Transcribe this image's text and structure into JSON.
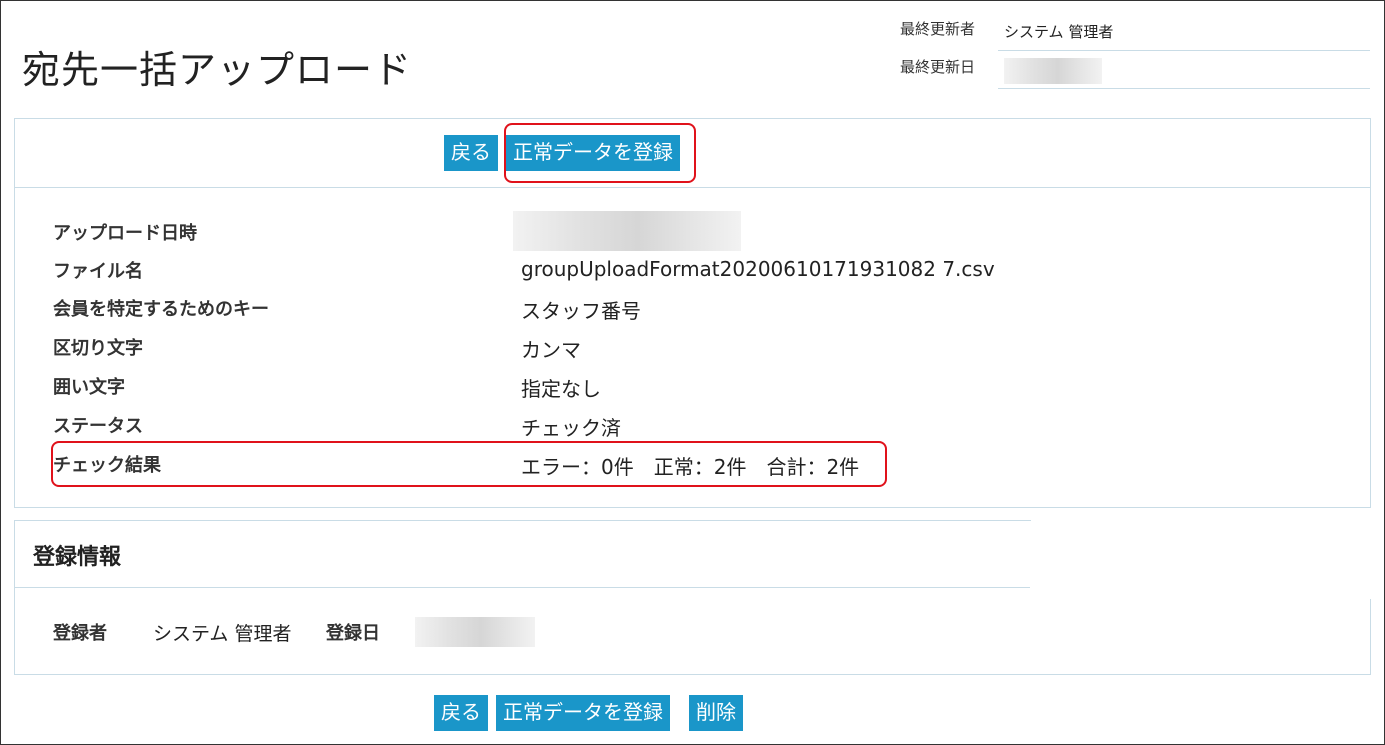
{
  "page": {
    "title": "宛先一括アップロード"
  },
  "meta": {
    "last_updated_by_label": "最終更新者",
    "last_updated_by_value": "システム 管理者",
    "last_updated_date_label": "最終更新日"
  },
  "toolbar_top": {
    "back_label": "戻る",
    "register_label": "正常データを登録"
  },
  "details": {
    "upload_datetime_label": "アップロード日時",
    "file_name_label": "ファイル名",
    "file_name_value": "groupUploadFormat20200610171931082 7.csv",
    "member_key_label": "会員を特定するためのキー",
    "member_key_value": "スタッフ番号",
    "delimiter_label": "区切り文字",
    "delimiter_value": "カンマ",
    "enclosure_label": "囲い文字",
    "enclosure_value": "指定なし",
    "status_label": "ステータス",
    "status_value": "チェック済",
    "check_result_label": "チェック結果",
    "check_result_value": "エラー：0件　正常：2件　合計：2件"
  },
  "registration": {
    "section_title": "登録情報",
    "registrant_label": "登録者",
    "registrant_value": "システム 管理者",
    "registered_date_label": "登録日"
  },
  "toolbar_bottom": {
    "back_label": "戻る",
    "register_label": "正常データを登録",
    "delete_label": "削除"
  },
  "colors": {
    "button_bg": "#1a96c9",
    "button_text": "#ffffff",
    "highlight": "#e0121b",
    "panel_border": "#c9dce6"
  }
}
